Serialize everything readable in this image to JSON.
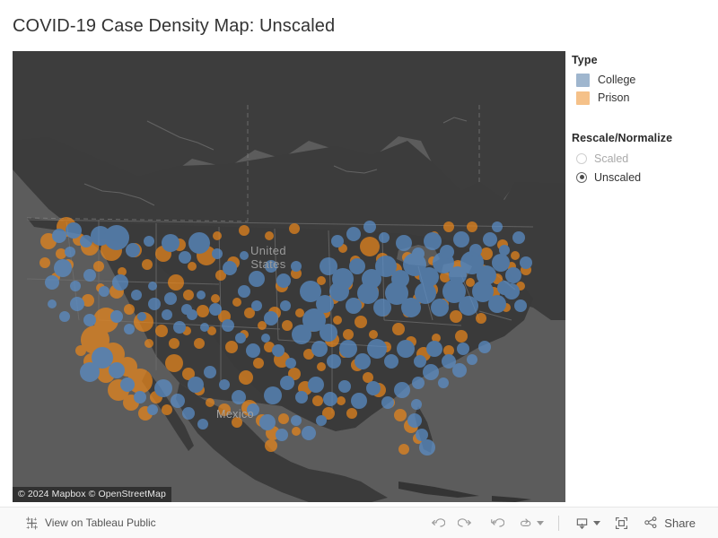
{
  "page": {
    "title": "COVID-19 Case Density Map: Unscaled",
    "background": "#ffffff"
  },
  "map": {
    "labels": {
      "country_us": "United\nStates",
      "country_mx": "Mexico"
    },
    "attribution": "© 2024 Mapbox  © OpenStreetMap",
    "basemap_style": "mapbox-dark",
    "colors": {
      "water": "#5c5c5c",
      "land": "#3b3b3b",
      "land_light": "#474747",
      "border": "#7d7d7d",
      "college_point": "#5b8fc9",
      "prison_point": "#e8861c"
    }
  },
  "legend": {
    "type": {
      "heading": "Type",
      "items": [
        {
          "label": "College",
          "color": "#9fb6ce"
        },
        {
          "label": "Prison",
          "color": "#f5c189"
        }
      ]
    },
    "rescale": {
      "heading": "Rescale/Normalize",
      "options": [
        {
          "label": "Scaled",
          "selected": false
        },
        {
          "label": "Unscaled",
          "selected": true
        }
      ]
    }
  },
  "toolbar": {
    "view_on_tableau": "View on Tableau Public",
    "tableau_icon": "tableau-logo-icon",
    "actions": [
      {
        "name": "undo",
        "icon": "undo-icon"
      },
      {
        "name": "redo",
        "icon": "redo-icon"
      },
      {
        "name": "revert",
        "icon": "revert-icon"
      },
      {
        "name": "refresh",
        "icon": "refresh-icon",
        "caret": true
      }
    ],
    "download": {
      "name": "download",
      "icon": "download-icon",
      "caret": true
    },
    "fullscreen": {
      "name": "fullscreen",
      "icon": "fullscreen-icon"
    },
    "share": {
      "label": "Share",
      "icon": "share-icon"
    }
  },
  "chart_data": {
    "type": "scatter",
    "title": "COVID-19 Case Density Map: Unscaled",
    "projection": "web-mercator",
    "legend_position": "right",
    "series": [
      {
        "name": "College",
        "color": "#5b8fc9",
        "marker": "circle",
        "opacity": 0.72
      },
      {
        "name": "Prison",
        "color": "#e8861c",
        "marker": "circle",
        "opacity": 0.72
      }
    ],
    "size_encoding": "case count (unscaled)",
    "extent": {
      "region": "North America",
      "countries": [
        "United States",
        "Mexico",
        "Canada"
      ]
    }
  }
}
